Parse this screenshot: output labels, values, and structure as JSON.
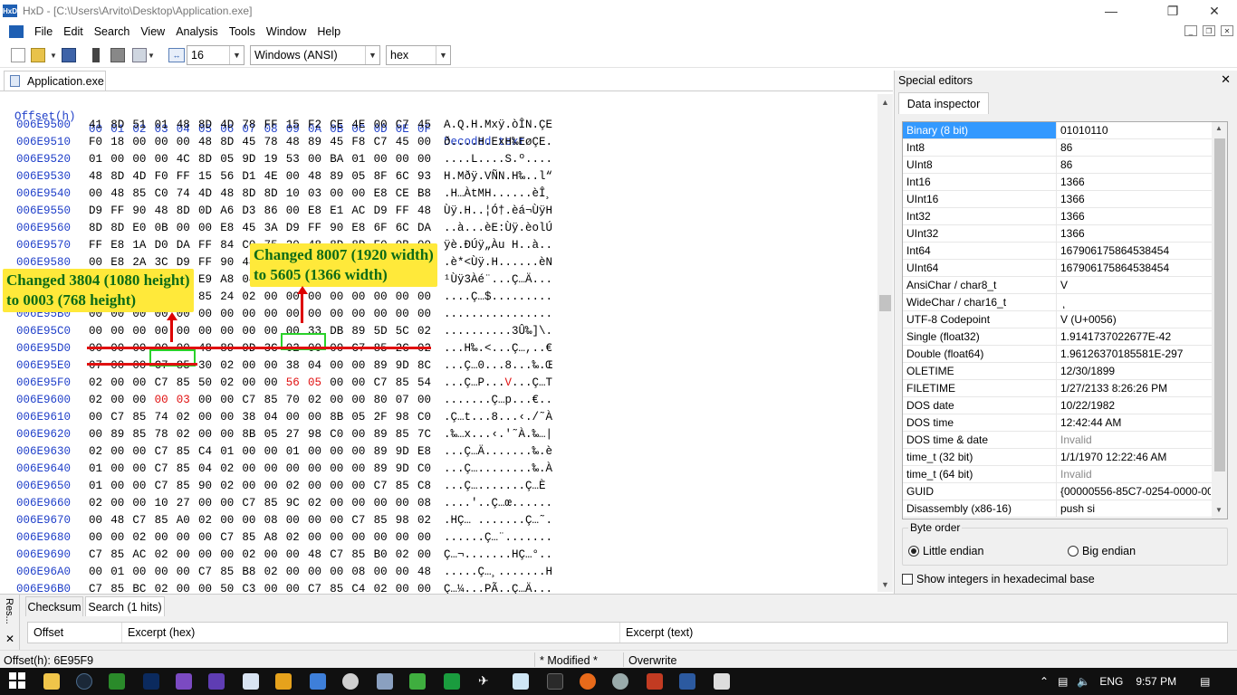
{
  "window": {
    "title": "HxD - [C:\\Users\\Arvito\\Desktop\\Application.exe]",
    "app_icon": "hxd-icon"
  },
  "menu": {
    "items": [
      "File",
      "Edit",
      "Search",
      "View",
      "Analysis",
      "Tools",
      "Window",
      "Help"
    ]
  },
  "toolbar": {
    "bytes_per_row": "16",
    "charset": "Windows (ANSI)",
    "offset_base": "hex"
  },
  "tab": {
    "label": "Application.exe"
  },
  "hex": {
    "header_offset": "Offset(h)",
    "header_bytes": [
      "00",
      "01",
      "02",
      "03",
      "04",
      "05",
      "06",
      "07",
      "08",
      "09",
      "0A",
      "0B",
      "0C",
      "0D",
      "0E",
      "0F"
    ],
    "header_decoded": "Decoded text",
    "rows": [
      {
        "off": "006E9500",
        "bytes": [
          "41",
          "8D",
          "51",
          "01",
          "48",
          "8D",
          "4D",
          "78",
          "FF",
          "15",
          "F2",
          "CE",
          "4E",
          "00",
          "C7",
          "45"
        ],
        "text": "A.Q.H.Mxÿ.òÎN.ÇE"
      },
      {
        "off": "006E9510",
        "bytes": [
          "F0",
          "18",
          "00",
          "00",
          "00",
          "48",
          "8D",
          "45",
          "78",
          "48",
          "89",
          "45",
          "F8",
          "C7",
          "45",
          "00"
        ],
        "text": "ð....H.ExH‰EøÇE."
      },
      {
        "off": "006E9520",
        "bytes": [
          "01",
          "00",
          "00",
          "00",
          "4C",
          "8D",
          "05",
          "9D",
          "19",
          "53",
          "00",
          "BA",
          "01",
          "00",
          "00",
          "00"
        ],
        "text": "....L....S.º...."
      },
      {
        "off": "006E9530",
        "bytes": [
          "48",
          "8D",
          "4D",
          "F0",
          "FF",
          "15",
          "56",
          "D1",
          "4E",
          "00",
          "48",
          "89",
          "05",
          "8F",
          "6C",
          "93"
        ],
        "text": "H.Mðÿ.VÑN.H‰..l“"
      },
      {
        "off": "006E9540",
        "bytes": [
          "00",
          "48",
          "85",
          "C0",
          "74",
          "4D",
          "48",
          "8D",
          "8D",
          "10",
          "03",
          "00",
          "00",
          "E8",
          "CE",
          "B8"
        ],
        "text": ".H…ÀtMH......èÎ¸"
      },
      {
        "off": "006E9550",
        "bytes": [
          "D9",
          "FF",
          "90",
          "48",
          "8D",
          "0D",
          "A6",
          "D3",
          "86",
          "00",
          "E8",
          "E1",
          "AC",
          "D9",
          "FF",
          "48"
        ],
        "text": "Ùÿ.H..¦Ó†.èá¬ÙÿH"
      },
      {
        "off": "006E9560",
        "bytes": [
          "8D",
          "8D",
          "E0",
          "0B",
          "00",
          "00",
          "E8",
          "45",
          "3A",
          "D9",
          "FF",
          "90",
          "E8",
          "6F",
          "6C",
          "DA"
        ],
        "text": "..à...èE:Ùÿ.èolÚ"
      },
      {
        "off": "006E9570",
        "bytes": [
          "FF",
          "E8",
          "1A",
          "D0",
          "DA",
          "FF",
          "84",
          "C0",
          "75",
          "20",
          "48",
          "8D",
          "8D",
          "E0",
          "0B",
          "00"
        ],
        "text": "ÿè.ÐÚÿ„Àu H..à.."
      },
      {
        "off": "006E9580",
        "bytes": [
          "00",
          "E8",
          "2A",
          "3C",
          "D9",
          "FF",
          "90",
          "48",
          "8D",
          "8D",
          "10",
          "03",
          "00",
          "00",
          "E8",
          "4E"
        ],
        "text": ".è*<Ùÿ.H......èN"
      },
      {
        "off": "006E9590",
        "bytes": [
          "B9",
          "D9",
          "FF",
          "33",
          "C0",
          "E9",
          "A8",
          "04",
          "00",
          "00",
          "C7",
          "85",
          "C4",
          "00",
          "00",
          "00"
        ],
        "text": "¹Ùÿ3Àé¨...Ç…Ä..."
      },
      {
        "off": "006E95A0",
        "bytes": [
          "00",
          "00",
          "00",
          "00",
          "C7",
          "85",
          "24",
          "02",
          "00",
          "00",
          "00",
          "00",
          "00",
          "00",
          "00",
          "00"
        ],
        "text": "....Ç…$........."
      },
      {
        "off": "006E95B0",
        "bytes": [
          "00",
          "00",
          "00",
          "00",
          "00",
          "00",
          "00",
          "00",
          "00",
          "00",
          "00",
          "00",
          "00",
          "00",
          "00",
          "00"
        ],
        "text": "................"
      },
      {
        "off": "006E95C0",
        "bytes": [
          "00",
          "00",
          "00",
          "00",
          "00",
          "00",
          "00",
          "00",
          "00",
          "00",
          "33",
          "DB",
          "89",
          "5D",
          "5C",
          "02"
        ],
        "text": "..........3Û‰]\\."
      },
      {
        "off": "006E95D0",
        "bytes": [
          "00",
          "00",
          "00",
          "00",
          "00",
          "48",
          "89",
          "9D",
          "3C",
          "02",
          "00",
          "00",
          "C7",
          "85",
          "2C",
          "02"
        ],
        "text": "...H‰.<...Ç…,..€"
      },
      {
        "off": "006E95E0",
        "bytes": [
          "07",
          "00",
          "00",
          "C7",
          "85",
          "30",
          "02",
          "00",
          "00",
          "38",
          "04",
          "00",
          "00",
          "89",
          "9D",
          "8C"
        ],
        "text": "...Ç…0...8...‰.Œ"
      },
      {
        "off": "006E95F0",
        "bytes": [
          "02",
          "00",
          "00",
          "C7",
          "85",
          "50",
          "02",
          "00",
          "00",
          "56",
          "05",
          "00",
          "00",
          "C7",
          "85",
          "54"
        ],
        "text": "...Ç…P...V...Ç…T"
      },
      {
        "off": "006E9600",
        "bytes": [
          "02",
          "00",
          "00",
          "00",
          "03",
          "00",
          "00",
          "C7",
          "85",
          "70",
          "02",
          "00",
          "00",
          "80",
          "07",
          "00"
        ],
        "text": ".......Ç…p...€.."
      },
      {
        "off": "006E9610",
        "bytes": [
          "00",
          "C7",
          "85",
          "74",
          "02",
          "00",
          "00",
          "38",
          "04",
          "00",
          "00",
          "8B",
          "05",
          "2F",
          "98",
          "C0"
        ],
        "text": ".Ç…t...8...‹./˜À"
      },
      {
        "off": "006E9620",
        "bytes": [
          "00",
          "89",
          "85",
          "78",
          "02",
          "00",
          "00",
          "8B",
          "05",
          "27",
          "98",
          "C0",
          "00",
          "89",
          "85",
          "7C"
        ],
        "text": ".‰…x...‹.'˜À.‰…|"
      },
      {
        "off": "006E9630",
        "bytes": [
          "02",
          "00",
          "00",
          "C7",
          "85",
          "C4",
          "01",
          "00",
          "00",
          "01",
          "00",
          "00",
          "00",
          "89",
          "9D",
          "E8"
        ],
        "text": "...Ç…Ä.......‰.è"
      },
      {
        "off": "006E9640",
        "bytes": [
          "01",
          "00",
          "00",
          "C7",
          "85",
          "04",
          "02",
          "00",
          "00",
          "00",
          "00",
          "00",
          "00",
          "89",
          "9D",
          "C0"
        ],
        "text": "...Ç…........‰.À"
      },
      {
        "off": "006E9650",
        "bytes": [
          "01",
          "00",
          "00",
          "C7",
          "85",
          "90",
          "02",
          "00",
          "00",
          "02",
          "00",
          "00",
          "00",
          "C7",
          "85",
          "C8"
        ],
        "text": "...Ç….......Ç…È"
      },
      {
        "off": "006E9660",
        "bytes": [
          "02",
          "00",
          "00",
          "10",
          "27",
          "00",
          "00",
          "C7",
          "85",
          "9C",
          "02",
          "00",
          "00",
          "00",
          "00",
          "08"
        ],
        "text": "....'..Ç…œ......"
      },
      {
        "off": "006E9670",
        "bytes": [
          "00",
          "48",
          "C7",
          "85",
          "A0",
          "02",
          "00",
          "00",
          "08",
          "00",
          "00",
          "00",
          "C7",
          "85",
          "98",
          "02"
        ],
        "text": ".HÇ… .......Ç…˜."
      },
      {
        "off": "006E9680",
        "bytes": [
          "00",
          "00",
          "02",
          "00",
          "00",
          "00",
          "C7",
          "85",
          "A8",
          "02",
          "00",
          "00",
          "00",
          "00",
          "00",
          "00"
        ],
        "text": "......Ç…¨......."
      },
      {
        "off": "006E9690",
        "bytes": [
          "C7",
          "85",
          "AC",
          "02",
          "00",
          "00",
          "00",
          "02",
          "00",
          "00",
          "48",
          "C7",
          "85",
          "B0",
          "02",
          "00"
        ],
        "text": "Ç…¬.......HÇ…°.."
      },
      {
        "off": "006E96A0",
        "bytes": [
          "00",
          "01",
          "00",
          "00",
          "00",
          "C7",
          "85",
          "B8",
          "02",
          "00",
          "00",
          "00",
          "08",
          "00",
          "00",
          "48"
        ],
        "text": ".....Ç…¸.......H"
      },
      {
        "off": "006E96B0",
        "bytes": [
          "C7",
          "85",
          "BC",
          "02",
          "00",
          "00",
          "50",
          "C3",
          "00",
          "00",
          "C7",
          "85",
          "C4",
          "02",
          "00",
          "00"
        ],
        "text": "Ç…¼...PÃ..Ç…Ä..."
      },
      {
        "off": "006E96C0",
        "bytes": [
          "02",
          "00",
          "00",
          "00",
          "89",
          "9D",
          "CC",
          "02",
          "00",
          "00",
          "48",
          "89",
          "9D",
          "D8",
          "02",
          "00"
        ],
        "text": "....‰.Ì...H‰.Ø.."
      },
      {
        "off": "006E96D0",
        "bytes": [
          "00",
          "48",
          "89",
          "5C",
          "24",
          "78",
          "F3",
          "0F",
          "10",
          "05",
          "32",
          "76",
          "74",
          "00",
          "F3",
          "0F"
        ],
        "text": ".H‰\\$xó...2vt.ó."
      },
      {
        "off": "006E96E0",
        "bytes": [
          "11",
          "45",
          "80",
          "48",
          "C7",
          "45",
          "84",
          "01",
          "00",
          "00",
          "00",
          "C7",
          "45",
          "AC",
          "00",
          "01"
        ],
        "text": ".E€HÇE„....ÇE¬.."
      },
      {
        "off": "006E96F0",
        "bytes": [
          "00",
          "00",
          "C7",
          "45",
          "B0",
          "01",
          "00",
          "00",
          "00",
          "C7",
          "45",
          "8C",
          "00",
          "00",
          "20",
          "00"
        ],
        "text": "..ÇE°....ÇEŒ.. ."
      },
      {
        "off": "006E9700",
        "bytes": [
          "C7",
          "45",
          "90",
          "00",
          "00",
          "50",
          "00",
          "48",
          "C7",
          "45",
          "94",
          "00",
          "00",
          "30",
          "00",
          "C7"
        ],
        "text": "ÇE...P.HÇE”..0.Ç"
      }
    ]
  },
  "annotations": {
    "left_note_1": "Changed 3804 (1080 height)",
    "left_note_2": "to 0003 (768 height)",
    "right_note_1": "Changed 8007 (1920 width)",
    "right_note_2": "to 5605 (1366 width)",
    "highlight_color": "#2ad12a",
    "underline_color": "#e01010"
  },
  "special_editors": {
    "title": "Special editors",
    "tab": "Data inspector",
    "rows": [
      {
        "name": "Binary (8 bit)",
        "value": "01010110",
        "selected": true
      },
      {
        "name": "Int8",
        "value": "86"
      },
      {
        "name": "UInt8",
        "value": "86"
      },
      {
        "name": "Int16",
        "value": "1366"
      },
      {
        "name": "UInt16",
        "value": "1366"
      },
      {
        "name": "Int32",
        "value": "1366"
      },
      {
        "name": "UInt32",
        "value": "1366"
      },
      {
        "name": "Int64",
        "value": "167906175864538454"
      },
      {
        "name": "UInt64",
        "value": "167906175864538454"
      },
      {
        "name": "AnsiChar / char8_t",
        "value": "V"
      },
      {
        "name": "WideChar / char16_t",
        "value": "ٖ"
      },
      {
        "name": "UTF-8 Codepoint",
        "value": "V (U+0056)"
      },
      {
        "name": "Single (float32)",
        "value": "1.9141737022677E-42"
      },
      {
        "name": "Double (float64)",
        "value": "1.96126370185581E-297"
      },
      {
        "name": "OLETIME",
        "value": "12/30/1899"
      },
      {
        "name": "FILETIME",
        "value": "1/27/2133 8:26:26 PM"
      },
      {
        "name": "DOS date",
        "value": "10/22/1982"
      },
      {
        "name": "DOS time",
        "value": "12:42:44 AM"
      },
      {
        "name": "DOS time & date",
        "value": "Invalid",
        "invalid": true
      },
      {
        "name": "time_t (32 bit)",
        "value": "1/1/1970 12:22:46 AM"
      },
      {
        "name": "time_t (64 bit)",
        "value": "Invalid",
        "invalid": true
      },
      {
        "name": "GUID",
        "value": "{00000556-85C7-0254-0000-000"
      },
      {
        "name": "Disassembly (x86-16)",
        "value": "push si"
      }
    ],
    "byte_order_label": "Byte order",
    "little_endian": "Little endian",
    "big_endian": "Big endian",
    "hex_checkbox": "Show integers in hexadecimal base"
  },
  "bottom_panel": {
    "side_label": "Res...",
    "tabs": [
      "Checksum",
      "Search (1 hits)"
    ],
    "columns": [
      "Offset",
      "Excerpt (hex)",
      "Excerpt (text)"
    ]
  },
  "status": {
    "offset": "Offset(h): 6E95F9",
    "modified": "* Modified *",
    "mode": "Overwrite"
  },
  "taskbar": {
    "language": "ENG",
    "time": "9:57 PM"
  }
}
